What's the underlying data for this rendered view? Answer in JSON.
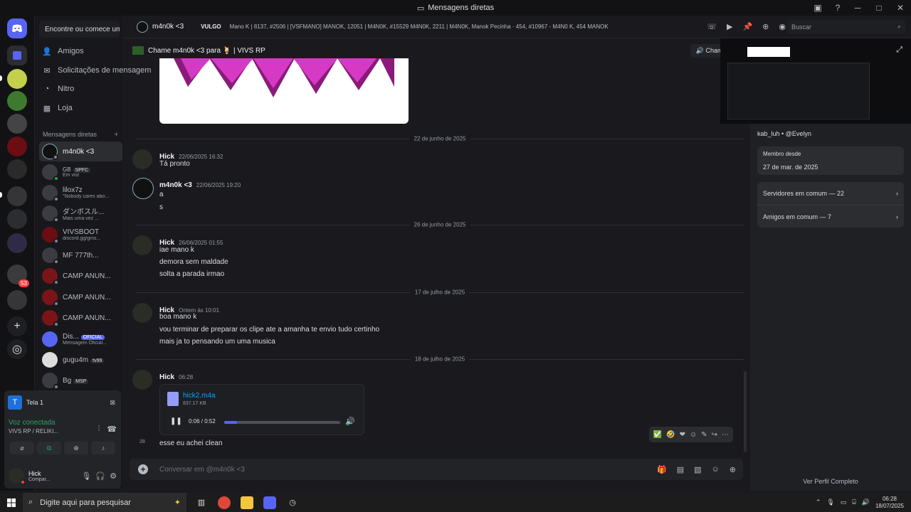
{
  "window": {
    "title": "Mensagens diretas"
  },
  "servers": {
    "badge": "53"
  },
  "sidebar": {
    "search_label": "Encontre ou comece uma conversa",
    "nav": [
      {
        "label": "Amigos"
      },
      {
        "label": "Solicitações de mensagem"
      },
      {
        "label": "Nitro"
      },
      {
        "label": "Loja"
      }
    ],
    "dm_header": "Mensagens diretas",
    "dms": [
      {
        "name": "m4n0k <3",
        "sub": ""
      },
      {
        "name": "GB",
        "tag": "SPFC",
        "sub": "Em voz"
      },
      {
        "name": "lilox7z",
        "sub": "\"Nobody cares abo..."
      },
      {
        "name": "ダンボスル...",
        "sub": "Mais uma vez ..."
      },
      {
        "name": "VIVSBOOT",
        "sub": "discord.gg/gms..."
      },
      {
        "name": "MF 777th...",
        "sub": ""
      },
      {
        "name": "CAMP ANUN...",
        "sub": ""
      },
      {
        "name": "CAMP ANUN...",
        "sub": ""
      },
      {
        "name": "CAMP ANUN...",
        "sub": ""
      },
      {
        "name": "Dis...",
        "tag": "OFICIAL",
        "sub": "Mensagem Oficial..."
      },
      {
        "name": "gugu4m",
        "tag": "tv99",
        "sub": ""
      },
      {
        "name": "Bg",
        "tag": "MSP",
        "sub": ""
      }
    ]
  },
  "share": {
    "label": "Tela 1",
    "tile": "T"
  },
  "voice": {
    "status": "Voz conectada",
    "server": "VIVS RP / RELIKI..."
  },
  "user": {
    "name": "Hick",
    "status": "Compar..."
  },
  "header": {
    "name": "m4n0k <3",
    "vulgo": "VULGO",
    "bio": "Mano K | 8137, #2506 | [VSFMANO] MANOK, 12051 | M4N0K, #15529 M4N0K, 2211 | M4N0K, Manok Pecinha · 454, #10967 - M4N0 K, 454 MANOK",
    "search_placeholder": "Buscar"
  },
  "notice": {
    "text": "Chame m4n0k <3 para 🍹 |  VIVS RP",
    "call_label": "Chamar para"
  },
  "chat": {
    "dates": [
      "22 de junho de 2025",
      "26 de junho de 2025",
      "17 de julho de 2025",
      "18 de julho de 2025"
    ],
    "messages": [
      {
        "author": "Hick",
        "time": "22/06/2025 16:32",
        "lines": [
          "Tá pronto"
        ]
      },
      {
        "author": "m4n0k <3",
        "time": "22/06/2025 19:20",
        "lines": [
          "a",
          "s"
        ]
      },
      {
        "author": "Hick",
        "time": "26/06/2025 01:55",
        "lines": [
          "iae mano k",
          "demora sem maldade",
          "solta a parada irmao"
        ]
      },
      {
        "author": "Hick",
        "time": "Ontem às 10:01",
        "lines": [
          "boa mano k",
          "vou terminar de preparar os clipe ate a amanha te envio tudo certinho",
          "mais  ja to pensando um uma musica"
        ]
      },
      {
        "author": "Hick",
        "time": "06:28",
        "lines": [
          "esse eu achei clean"
        ]
      }
    ],
    "short_time": "28",
    "attachment": {
      "filename": "hick2.m4a",
      "size": "837.17 KB",
      "time": "0:06 / 0:52",
      "progress": 0.11
    }
  },
  "composer": {
    "placeholder": "Conversar em @m4n0k <3"
  },
  "profile": {
    "name": "m4n0k <3",
    "handle": "kab_luh • @Evelyn",
    "member_since_label": "Membro desde",
    "member_since": "27 de mar. de 2025",
    "mutual_servers": "Servidores em comum — 22",
    "mutual_friends": "Amigos em comum — 7",
    "full_profile": "Ver Perfil Completo"
  },
  "taskbar": {
    "search": "Digite aqui para pesquisar",
    "time": "06:28",
    "date": "18/07/2025"
  }
}
